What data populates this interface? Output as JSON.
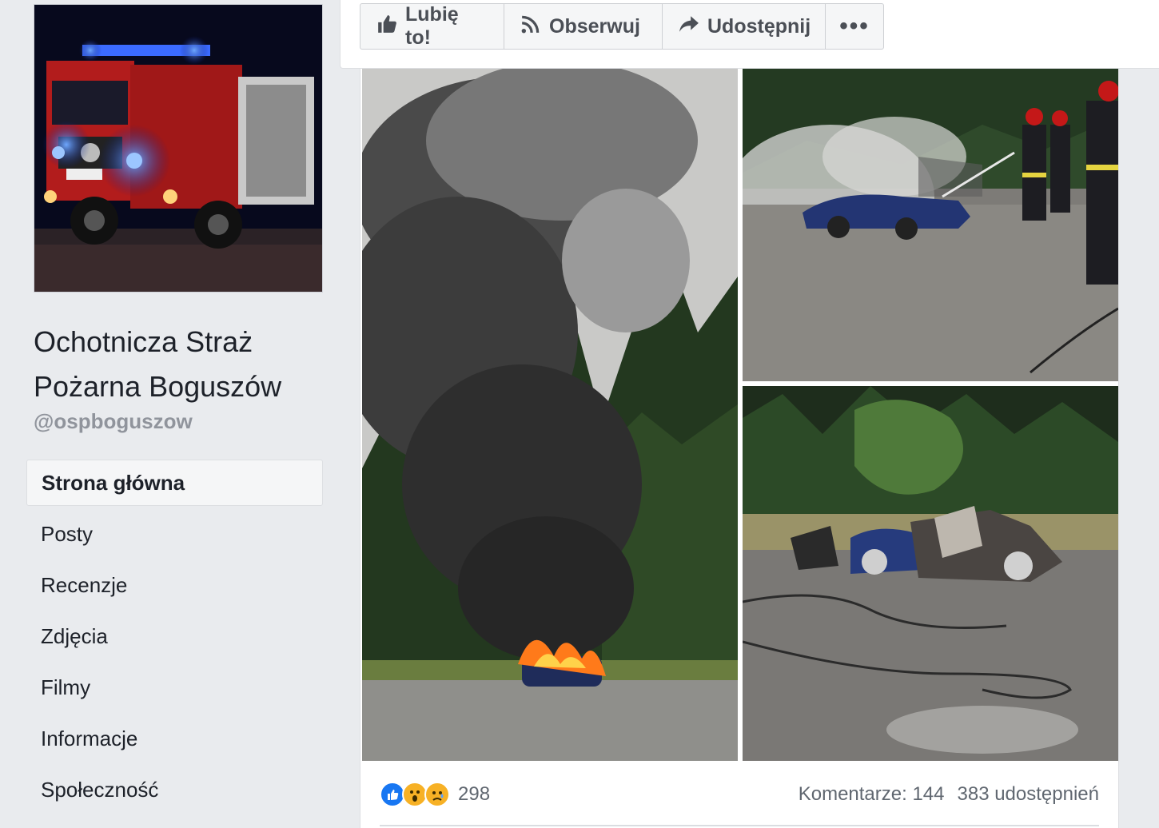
{
  "page": {
    "name": "Ochotnicza Straż Pożarna Boguszów",
    "handle": "@ospboguszow"
  },
  "nav": {
    "items": [
      {
        "label": "Strona główna",
        "active": true
      },
      {
        "label": "Posty"
      },
      {
        "label": "Recenzje"
      },
      {
        "label": "Zdjęcia"
      },
      {
        "label": "Filmy"
      },
      {
        "label": "Informacje"
      },
      {
        "label": "Społeczność"
      }
    ]
  },
  "actions": {
    "like": "Lubię to!",
    "follow": "Obserwuj",
    "share": "Udostępnij",
    "more": "•••"
  },
  "icons": {
    "like": "thumbs-up-icon",
    "follow": "rss-icon",
    "share": "share-arrow-icon",
    "more": "more-dots-icon"
  },
  "post": {
    "reaction_count": "298",
    "comments": "Komentarze: 144",
    "shares": "383 udostępnień"
  },
  "colors": {
    "background": "#e9ebee",
    "like_blue": "#1877f2",
    "emoji_yellow": "#f7b125"
  }
}
